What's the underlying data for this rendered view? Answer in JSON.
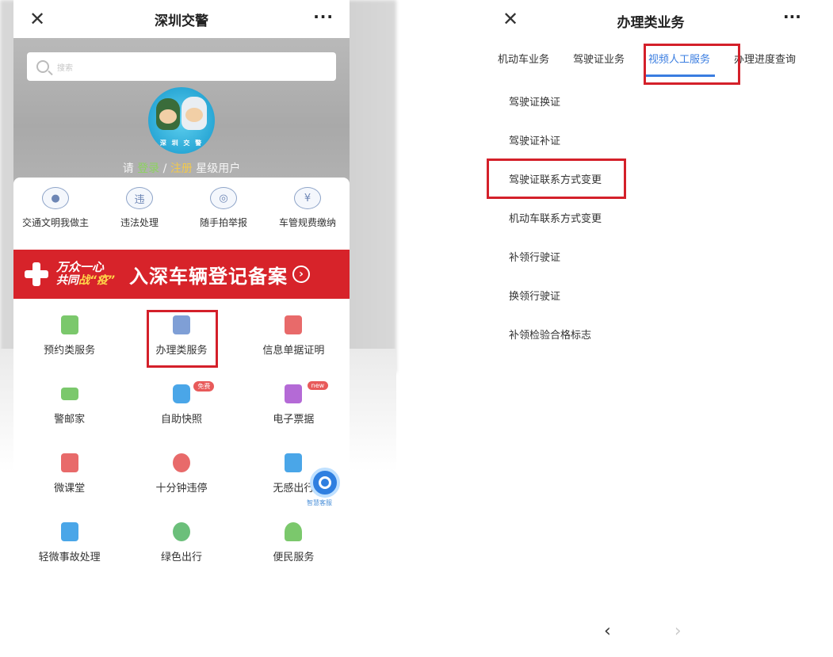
{
  "left": {
    "title": "深圳交警",
    "close_glyph": "✕",
    "more_glyph": "···",
    "search_placeholder": "搜索",
    "avatar_caption": "深 圳 交 警",
    "login": {
      "prefix": "请 ",
      "login": "登录",
      "sep": " / ",
      "register": "注册",
      "suffix": " 星级用户"
    },
    "quick": [
      {
        "label": "交通文明我做主",
        "icon": "user-cloud-icon",
        "glyph": "●"
      },
      {
        "label": "违法处理",
        "icon": "violation-icon",
        "glyph": "违"
      },
      {
        "label": "随手拍举报",
        "icon": "camera-icon",
        "glyph": "◎"
      },
      {
        "label": "车管规费缴纳",
        "icon": "yuan-icon",
        "glyph": "¥"
      }
    ],
    "banner": {
      "slogan1": "万众一心",
      "slogan2a": "共同",
      "slogan2b": "战“疫”",
      "headline": "入深车辆登记备案",
      "arrow": "›"
    },
    "services": [
      [
        {
          "label": "预约类服务",
          "icon": "appointment-icon",
          "color": "#7bc86c"
        },
        {
          "label": "办理类服务",
          "icon": "handling-icon",
          "color": "#7f9fd6"
        },
        {
          "label": "信息单据证明",
          "icon": "document-icon",
          "color": "#e86a6a"
        }
      ],
      [
        {
          "label": "警邮家",
          "icon": "mail-icon",
          "color": "#7bc86c"
        },
        {
          "label": "自助快照",
          "icon": "photo-icon",
          "color": "#4aa6e8",
          "tag": "免费"
        },
        {
          "label": "电子票据",
          "icon": "receipt-icon",
          "color": "#b46ad6",
          "tag": "new"
        }
      ],
      [
        {
          "label": "微课堂",
          "icon": "book-icon",
          "color": "#e86a6a"
        },
        {
          "label": "十分钟违停",
          "icon": "parking-icon",
          "color": "#e86a6a"
        },
        {
          "label": "无感出行",
          "icon": "etc-icon",
          "color": "#4aa6e8"
        }
      ],
      [
        {
          "label": "轻微事故处理",
          "icon": "accident-icon",
          "color": "#4aa6e8"
        },
        {
          "label": "绿色出行",
          "icon": "green-travel-icon",
          "color": "#6bbf7a"
        },
        {
          "label": "便民服务",
          "icon": "service-icon",
          "color": "#7bc86c"
        }
      ]
    ],
    "float_label": "智慧客服"
  },
  "right": {
    "title": "办理类业务",
    "close_glyph": "✕",
    "more_glyph": "···",
    "tabs": [
      "机动车业务",
      "驾驶证业务",
      "视频人工服务",
      "办理进度查询"
    ],
    "active_tab": "视频人工服务",
    "items": [
      "驾驶证换证",
      "驾驶证补证",
      "驾驶证联系方式变更",
      "机动车联系方式变更",
      "补领行驶证",
      "换领行驶证",
      "补领检验合格标志"
    ],
    "back_glyph": "‹",
    "forward_glyph": "›"
  },
  "colors": {
    "highlight": "#d4202a",
    "tab_active": "#3a7de0",
    "banner": "#d7232a"
  }
}
